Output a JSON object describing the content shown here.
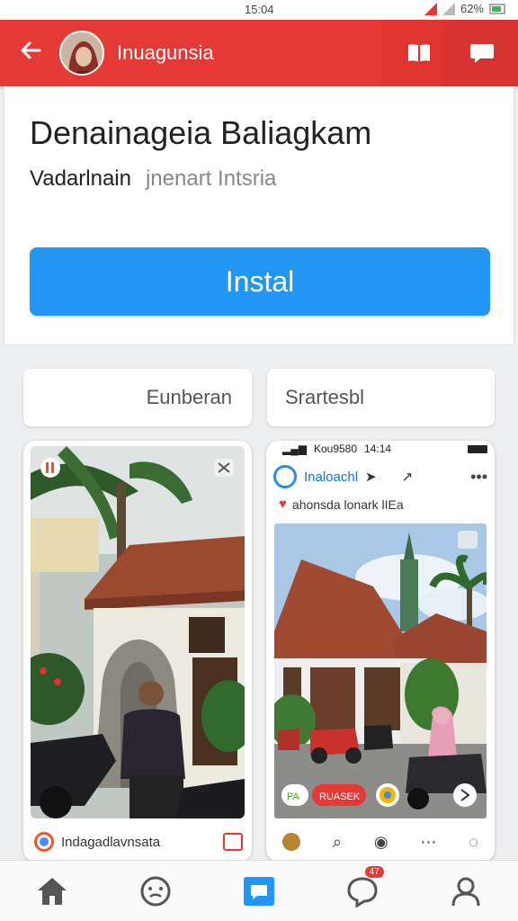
{
  "status": {
    "time": "15:04",
    "battery": "62%"
  },
  "app_bar": {
    "title": "Inuagunsia"
  },
  "app_info": {
    "name": "Denainageia Baliagkam",
    "subtitle_primary": "Vadarlnain",
    "subtitle_secondary": "jnenart Intsria",
    "install_label": "Instal"
  },
  "chips": {
    "left": "Eunberan",
    "right": "Srartesbl"
  },
  "screenshot_left": {
    "footer_text": "Indagadlavnsata"
  },
  "screenshot_right": {
    "status_left": "Kou9580",
    "status_time": "14:14",
    "header_title": "Inaloachl",
    "subtitle": "ahonsda lonark lIEa",
    "more_label": "•••",
    "tag_a": "PA",
    "tag_b": "RUASEK"
  },
  "bottom_nav": {
    "items": [
      {
        "icon": "home-icon"
      },
      {
        "icon": "smiley-icon"
      },
      {
        "icon": "message-square-icon"
      },
      {
        "icon": "chat-bubble-icon",
        "badge": "47"
      },
      {
        "icon": "profile-icon"
      }
    ]
  },
  "colors": {
    "app_bar": "#e53935",
    "install": "#2196f3",
    "accent": "#1a73c8"
  }
}
